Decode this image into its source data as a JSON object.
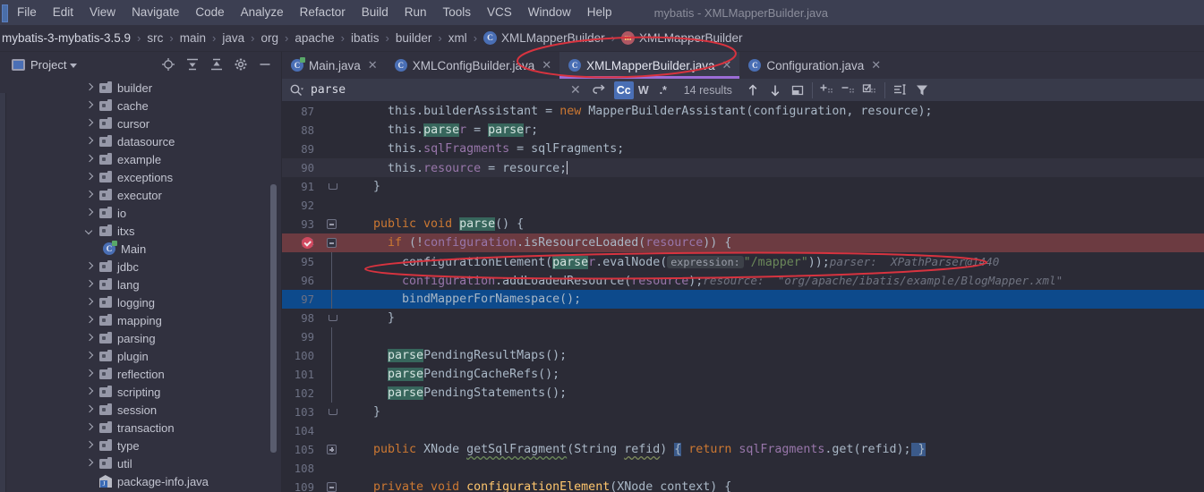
{
  "window": {
    "title": "mybatis - XMLMapperBuilder.java"
  },
  "menubar": {
    "items": [
      "File",
      "Edit",
      "View",
      "Navigate",
      "Code",
      "Analyze",
      "Refactor",
      "Build",
      "Run",
      "Tools",
      "VCS",
      "Window",
      "Help"
    ]
  },
  "breadcrumb": {
    "items": [
      {
        "label": "mybatis-3-mybatis-3.5.9",
        "icon": null
      },
      {
        "label": "src",
        "icon": null
      },
      {
        "label": "main",
        "icon": null
      },
      {
        "label": "java",
        "icon": null
      },
      {
        "label": "org",
        "icon": null
      },
      {
        "label": "apache",
        "icon": null
      },
      {
        "label": "ibatis",
        "icon": null
      },
      {
        "label": "builder",
        "icon": null
      },
      {
        "label": "xml",
        "icon": null
      },
      {
        "label": "XMLMapperBuilder",
        "icon": "class-icon",
        "icon_letter": "C"
      },
      {
        "label": "XMLMapperBuilder",
        "icon": "method-icon",
        "icon_letter": "m"
      }
    ],
    "separator": "›"
  },
  "project_panel": {
    "title": "Project",
    "tools": [
      "locate-icon",
      "expand-all-icon",
      "collapse-all-icon",
      "gear-icon",
      "hide-icon"
    ],
    "tree": [
      {
        "label": "builder",
        "type": "folder",
        "state": "collapsed",
        "depth": 0
      },
      {
        "label": "cache",
        "type": "folder",
        "state": "collapsed",
        "depth": 0
      },
      {
        "label": "cursor",
        "type": "folder",
        "state": "collapsed",
        "depth": 0
      },
      {
        "label": "datasource",
        "type": "folder",
        "state": "collapsed",
        "depth": 0
      },
      {
        "label": "example",
        "type": "folder",
        "state": "collapsed",
        "depth": 0
      },
      {
        "label": "exceptions",
        "type": "folder",
        "state": "collapsed",
        "depth": 0
      },
      {
        "label": "executor",
        "type": "folder",
        "state": "collapsed",
        "depth": 0
      },
      {
        "label": "io",
        "type": "folder",
        "state": "collapsed",
        "depth": 0
      },
      {
        "label": "itxs",
        "type": "folder",
        "state": "expanded",
        "depth": 0
      },
      {
        "label": "Main",
        "type": "class",
        "state": "leaf",
        "depth": 1
      },
      {
        "label": "jdbc",
        "type": "folder",
        "state": "collapsed",
        "depth": 0
      },
      {
        "label": "lang",
        "type": "folder",
        "state": "collapsed",
        "depth": 0
      },
      {
        "label": "logging",
        "type": "folder",
        "state": "collapsed",
        "depth": 0
      },
      {
        "label": "mapping",
        "type": "folder",
        "state": "collapsed",
        "depth": 0
      },
      {
        "label": "parsing",
        "type": "folder",
        "state": "collapsed",
        "depth": 0
      },
      {
        "label": "plugin",
        "type": "folder",
        "state": "collapsed",
        "depth": 0
      },
      {
        "label": "reflection",
        "type": "folder",
        "state": "collapsed",
        "depth": 0
      },
      {
        "label": "scripting",
        "type": "folder",
        "state": "collapsed",
        "depth": 0
      },
      {
        "label": "session",
        "type": "folder",
        "state": "collapsed",
        "depth": 0
      },
      {
        "label": "transaction",
        "type": "folder",
        "state": "collapsed",
        "depth": 0
      },
      {
        "label": "type",
        "type": "folder",
        "state": "collapsed",
        "depth": 0
      },
      {
        "label": "util",
        "type": "folder",
        "state": "collapsed",
        "depth": 0
      },
      {
        "label": "package-info.java",
        "type": "package-info",
        "state": "leaf",
        "depth": 0
      }
    ]
  },
  "editor_tabs": [
    {
      "label": "Main.java",
      "icon_letter": "C",
      "active": false,
      "runnable": true
    },
    {
      "label": "XMLConfigBuilder.java",
      "icon_letter": "C",
      "active": false,
      "runnable": false
    },
    {
      "label": "XMLMapperBuilder.java",
      "icon_letter": "C",
      "active": true,
      "runnable": false
    },
    {
      "label": "Configuration.java",
      "icon_letter": "C",
      "active": false,
      "runnable": false
    }
  ],
  "find_bar": {
    "query": "parse",
    "placeholder": "Search",
    "results_text": "14 results",
    "toggles": [
      {
        "name": "match-case",
        "label": "Cc",
        "active": true
      },
      {
        "name": "words",
        "label": "W",
        "active": false
      },
      {
        "name": "regex",
        "label": ".*",
        "active": false
      }
    ],
    "icons": [
      "close-icon",
      "history-icon",
      "prev-occurrence-icon",
      "next-occurrence-icon",
      "select-all-icon",
      "add-line-icon",
      "remove-line-icon",
      "edit-line-icon",
      "filter-scope-icon",
      "filter-icon"
    ]
  },
  "code": {
    "lines": [
      {
        "num": "87",
        "highlight": "none",
        "fold": "none"
      },
      {
        "num": "88",
        "highlight": "none",
        "fold": "none"
      },
      {
        "num": "89",
        "highlight": "none",
        "fold": "none"
      },
      {
        "num": "90",
        "highlight": "caret",
        "fold": "none"
      },
      {
        "num": "91",
        "highlight": "none",
        "fold": "end"
      },
      {
        "num": "92",
        "highlight": "none",
        "fold": "none"
      },
      {
        "num": "93",
        "highlight": "none",
        "fold": "minus"
      },
      {
        "num": "94",
        "highlight": "exec",
        "fold": "minus",
        "breakpoint": true
      },
      {
        "num": "95",
        "highlight": "none",
        "fold": "none"
      },
      {
        "num": "96",
        "highlight": "none",
        "fold": "none"
      },
      {
        "num": "97",
        "highlight": "selected",
        "fold": "none"
      },
      {
        "num": "98",
        "highlight": "none",
        "fold": "end"
      },
      {
        "num": "99",
        "highlight": "none",
        "fold": "none"
      },
      {
        "num": "100",
        "highlight": "none",
        "fold": "none"
      },
      {
        "num": "101",
        "highlight": "none",
        "fold": "none"
      },
      {
        "num": "102",
        "highlight": "none",
        "fold": "none"
      },
      {
        "num": "103",
        "highlight": "none",
        "fold": "end"
      },
      {
        "num": "104",
        "highlight": "none",
        "fold": "none"
      },
      {
        "num": "105",
        "highlight": "none",
        "fold": "plus"
      },
      {
        "num": "108",
        "highlight": "none",
        "fold": "none"
      },
      {
        "num": "109",
        "highlight": "none",
        "fold": "minus"
      }
    ],
    "text": {
      "l87": "    this.builderAssistant = new MapperBuilderAssistant(configuration, resource);",
      "l88": "    this.parser = parser;",
      "l89": "    this.sqlFragments = sqlFragments;",
      "l90": "    this.resource = resource;",
      "l91": "  }",
      "l92": "",
      "l93": "  public void parse() {",
      "l94": "    if (!configuration.isResourceLoaded(resource)) {",
      "l95": "      configurationElement(parser.evalNode(\"/mapper\"));",
      "l95hint_label": "expression:",
      "l95inline": "parser:  XPathParser@1440",
      "l96": "      configuration.addLoadedResource(resource);",
      "l96inline": "resource:  \"org/apache/ibatis/example/BlogMapper.xml\"",
      "l97": "      bindMapperForNamespace();",
      "l98": "    }",
      "l99": "",
      "l100": "    parsePendingResultMaps();",
      "l101": "    parsePendingCacheRefs();",
      "l102": "    parsePendingStatements();",
      "l103": "  }",
      "l104": "",
      "l105": "  public XNode getSqlFragment(String refid) { return sqlFragments.get(refid); }",
      "l108": "",
      "l109": "  private void configurationElement(XNode context) {"
    }
  },
  "colors": {
    "accent_purple": "#9b6cd6",
    "annotation_red": "#d8333f",
    "exec_line": "#6c3b41",
    "selected_line": "#0d4a8c",
    "match_highlight": "#37665c",
    "keyword": "#cc7832",
    "string": "#6a8759",
    "field": "#9876aa",
    "method": "#ffc66d",
    "editor_bg": "#2b2b36",
    "panel_bg": "#31313f"
  }
}
